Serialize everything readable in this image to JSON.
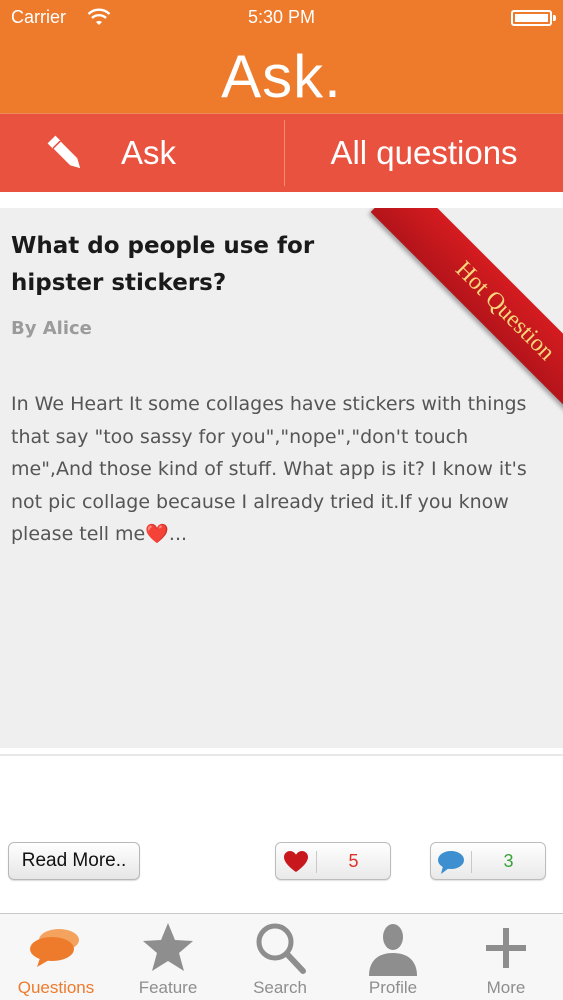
{
  "status_bar": {
    "carrier": "Carrier",
    "time": "5:30 PM"
  },
  "header": {
    "title": "Ask."
  },
  "segments": {
    "ask_label": "Ask",
    "all_label": "All questions"
  },
  "question": {
    "title": "What do people use for hipster stickers?",
    "author": "By Alice",
    "body": "In We Heart It some collages have stickers with things that say \"too sassy for you\",\"nope\",\"don't touch me\",And those kind of stuff. What app is it? I know it's not pic collage because I already tried it.If you know please tell me",
    "body_heart": "❤️",
    "body_ellipsis": "...",
    "ribbon": "Hot Question"
  },
  "actions": {
    "read_more": "Read More..",
    "likes": "5",
    "comments": "3"
  },
  "colors": {
    "header": "#ee7b2c",
    "segment": "#e9523f",
    "ribbon": "#c8181d",
    "like": "#e0302a",
    "comment": "#3aa23a"
  },
  "tabs": [
    {
      "label": "Questions",
      "icon": "chat-bubbles-icon",
      "active": true
    },
    {
      "label": "Feature",
      "icon": "star-icon"
    },
    {
      "label": "Search",
      "icon": "magnifier-icon"
    },
    {
      "label": "Profile",
      "icon": "person-icon"
    },
    {
      "label": "More",
      "icon": "plus-icon"
    }
  ]
}
